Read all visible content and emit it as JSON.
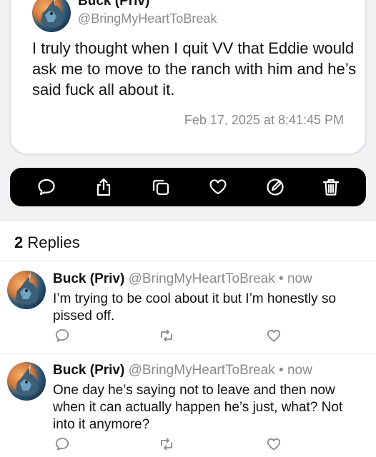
{
  "post": {
    "author_name": "Buck (Priv)",
    "handle": "@BringMyHeartToBreak",
    "text": "I truly thought when I quit VV that Eddie would ask me to move to the ranch with him and he’s said fuck all about it.",
    "timestamp": "Feb 17, 2025 at 8:41:45 PM"
  },
  "action_bar": {
    "icons": [
      "reply-icon",
      "share-icon",
      "copy-icon",
      "heart-icon",
      "edit-icon",
      "trash-icon"
    ]
  },
  "replies_header": {
    "count": "2",
    "label": "Replies"
  },
  "replies": [
    {
      "author_name": "Buck (Priv)",
      "handle": "@BringMyHeartToBreak",
      "separator": "•",
      "time": "now",
      "text": "I’m trying to be cool about it but I’m honestly so pissed off."
    },
    {
      "author_name": "Buck (Priv)",
      "handle": "@BringMyHeartToBreak",
      "separator": "•",
      "time": "now",
      "text": "One day he’s saying not to leave and then now when it can actually happen he’s just, what? Not into it anymore?"
    }
  ],
  "colors": {
    "background_top": "#f2f2f4",
    "action_bar": "#000000",
    "secondary_text": "#8a8a8e",
    "icon_gray": "#8a8a8e"
  }
}
